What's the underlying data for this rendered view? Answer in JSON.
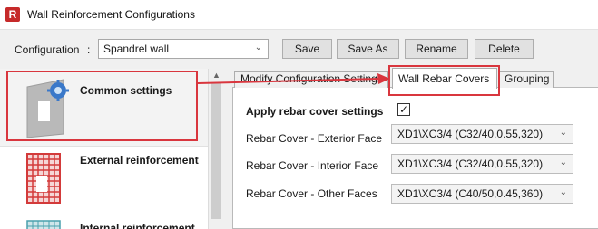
{
  "window": {
    "title": "Wall Reinforcement Configurations",
    "icon": "R"
  },
  "config": {
    "label": "Configuration",
    "colon": ":",
    "selected": "Spandrel wall",
    "buttons": {
      "save": "Save",
      "save_as": "Save As",
      "rename": "Rename",
      "delete": "Delete"
    }
  },
  "sidebar": {
    "items": [
      {
        "label": "Common settings"
      },
      {
        "label": "External reinforcement"
      },
      {
        "label": "Internal reinforcement"
      }
    ]
  },
  "tabs": [
    {
      "label": "Modify Configuration Settings"
    },
    {
      "label": "Wall Rebar Covers"
    },
    {
      "label": "Grouping"
    }
  ],
  "content": {
    "apply_label": "Apply rebar cover settings",
    "apply_checked": "✓",
    "fields": [
      {
        "label": "Rebar Cover - Exterior Face",
        "value": "XD1\\XC3/4 (C32/40,0.55,320)"
      },
      {
        "label": "Rebar Cover - Interior Face",
        "value": "XD1\\XC3/4 (C32/40,0.55,320)"
      },
      {
        "label": "Rebar Cover - Other Faces",
        "value": "XD1\\XC3/4 (C40/50,0.45,360)"
      }
    ]
  },
  "colors": {
    "highlight": "#d9363e",
    "accent": "#3a78c9",
    "mesh": "#d33a3a"
  }
}
